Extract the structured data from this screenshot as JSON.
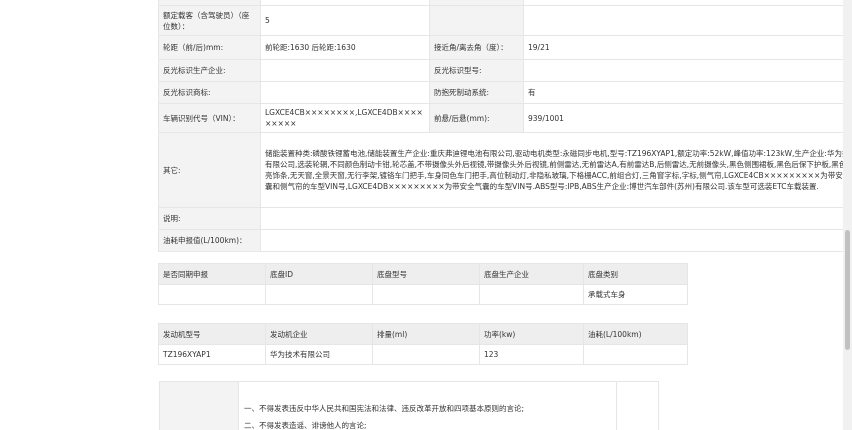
{
  "spec": {
    "seats_label": "额定载客（含驾驶员）（座位数）：",
    "seats_value": "5",
    "wheelbase_label": "轮距（前/后)mm:",
    "wheelbase_value": "前轮距:1630 后轮距:1630",
    "approach_label": "接近角/离去角（度）：",
    "approach_value": "19/21",
    "reflector_maker_label": "反光标识生产企业:",
    "reflector_maker_value": "",
    "reflector_model_label": "反光标识型号:",
    "reflector_model_value": "",
    "reflector_brand_label": "反光标识商标:",
    "reflector_brand_value": "",
    "abs_label": "防抱死制动系统:",
    "abs_value": "有",
    "vin_label": "车辆识别代号（VIN）：",
    "vin_value": "LGXCE4CB××××××××,LGXCE4DB×××××××××",
    "overhang_label": "前悬/后悬(mm):",
    "overhang_value": "939/1001",
    "other_label": "其它:",
    "other_value": "储能装置种类:磷酸铁锂蓄电池,储能装置生产企业:重庆弗迪锂电池有限公司,驱动电机类型:永磁同步电机,型号:TZ196XYAP1,额定功率:52kW,峰值功率:123kW,生产企业:华为技术有限公司,选装轮辋,不同颜色制动卡钳,轮芯盖,不带摄像头外后视镜,带摄像头外后视镜,前侧雷达,无前雷达A,有前雷达B,后侧雷达,无前摄像头,黑色侧围裙板,黑色后保下护板,黑色风窗亮饰条,无天窗,全景天窗,无行李架,镀铬车门把手,车身同色车门把手,高位制动灯,非隐私玻璃,下格栅ACC,前组合灯,三角窗字标,字标,侧气帘,LGXCE4CB×××××××××为带安全气囊和侧气帘的车型VIN号,LGXCE4DB×××××××××为带安全气囊的车型VIN号.ABS型号:IPB,ABS生产企业:博世汽车部件(苏州)有限公司.该车型可选装ETC车载装置.",
    "note_label": "说明:",
    "note_value": "",
    "fuel_label": "油耗申报值(L/100km)：",
    "fuel_value": ""
  },
  "chassis": {
    "headers": [
      "是否同期申报",
      "底盘ID",
      "底盘型号",
      "底盘生产企业",
      "底盘类别"
    ],
    "row": [
      "",
      "",
      "",
      "",
      "承载式车身"
    ]
  },
  "engine": {
    "headers": [
      "发动机型号",
      "发动机企业",
      "排量(ml)",
      "功率(kw)",
      "油耗(L/100km)"
    ],
    "row": [
      "TZ196XYAP1",
      "华为技术有限公司",
      "",
      "123",
      ""
    ]
  },
  "notice": {
    "line1": "一、不得发表违反中华人民共和国宪法和法律、违反改革开放和四项基本原则的言论;",
    "line2": "二、不得发表造谣、诽谤他人的言论;"
  }
}
